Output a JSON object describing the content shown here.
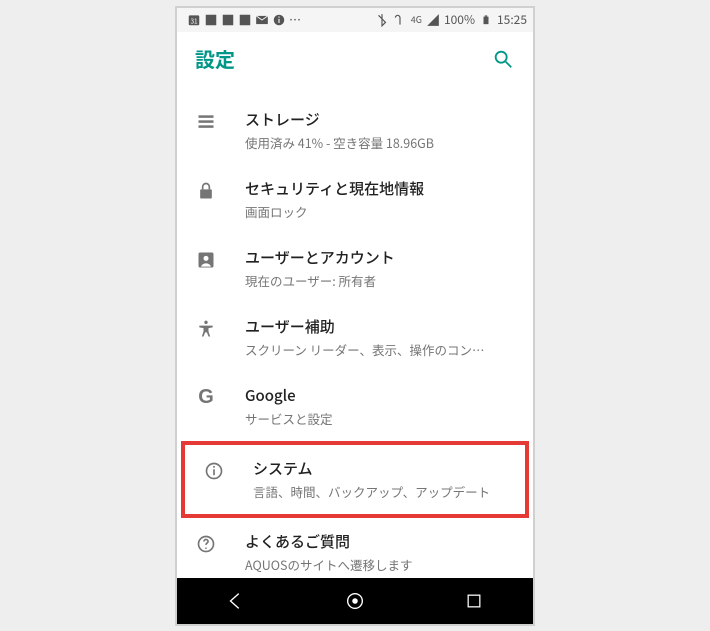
{
  "statusbar": {
    "battery_pct": "100%",
    "time": "15:25",
    "network_label": "4G"
  },
  "appbar": {
    "title": "設定"
  },
  "items": [
    {
      "icon": "storage",
      "title": "ストレージ",
      "sub": "使用済み 41% - 空き容量 18.96GB"
    },
    {
      "icon": "lock",
      "title": "セキュリティと現在地情報",
      "sub": "画面ロック"
    },
    {
      "icon": "person-box",
      "title": "ユーザーとアカウント",
      "sub": "現在のユーザー: 所有者"
    },
    {
      "icon": "accessibility",
      "title": "ユーザー補助",
      "sub": "スクリーン リーダー、表示、操作のコン…"
    },
    {
      "icon": "google-g",
      "title": "Google",
      "sub": "サービスと設定"
    },
    {
      "icon": "info",
      "title": "システム",
      "sub": "言語、時間、バックアップ、アップデート",
      "highlight": true
    },
    {
      "icon": "help",
      "title": "よくあるご質問",
      "sub": "AQUOSのサイトへ遷移します"
    }
  ]
}
